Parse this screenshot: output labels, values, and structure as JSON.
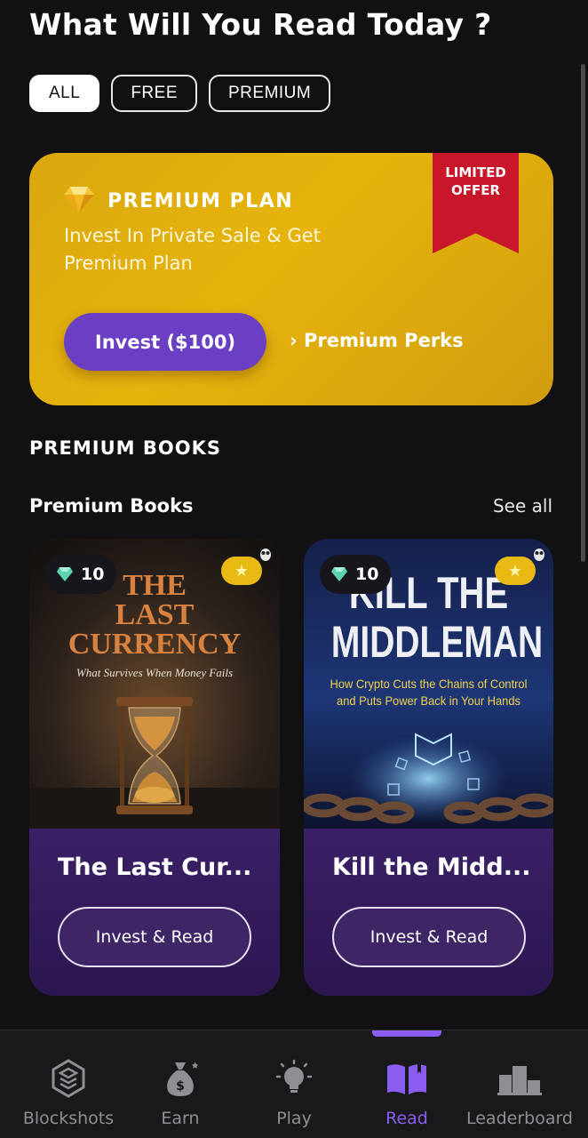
{
  "header": {
    "title": "What Will You Read Today ?"
  },
  "filters": [
    {
      "label": "ALL",
      "active": true
    },
    {
      "label": "FREE",
      "active": false
    },
    {
      "label": "PREMIUM",
      "active": false
    }
  ],
  "promo": {
    "ribbon_line1": "LIMITED",
    "ribbon_line2": "OFFER",
    "title": "PREMIUM PLAN",
    "subtitle": "Invest In Private Sale & Get Premium Plan",
    "cta_label": "Invest ($100)",
    "perks_label": "› Premium Perks",
    "icon": "diamond-icon"
  },
  "section": {
    "title": "PREMIUM BOOKS",
    "subtitle": "Premium Books",
    "see_all": "See all"
  },
  "books": [
    {
      "title": "The Last Cur...",
      "price": "10",
      "button_label": "Invest & Read",
      "cover": {
        "line1": "THE",
        "line2": "LAST",
        "line3": "CURRENCY",
        "tagline": "What Survives When Money Fails"
      }
    },
    {
      "title": "Kill the Midd...",
      "price": "10",
      "button_label": "Invest & Read",
      "cover": {
        "line1": "KILL THE",
        "line2": "MIDDLEMAN",
        "tagline1": "How Crypto Cuts the Chains of Control",
        "tagline2": "and Puts Power Back in Your Hands"
      }
    }
  ],
  "nav": {
    "items": [
      {
        "label": "Blockshots",
        "icon": "layers-icon"
      },
      {
        "label": "Earn",
        "icon": "money-bag-icon"
      },
      {
        "label": "Play",
        "icon": "lightbulb-icon"
      },
      {
        "label": "Read",
        "icon": "book-icon",
        "active": true
      },
      {
        "label": "Leaderboard",
        "icon": "podium-icon"
      }
    ]
  },
  "colors": {
    "background": "#111114",
    "accent": "#8a5cf0",
    "promo_gold": "#e6b40c",
    "ribbon_red": "#c8162a",
    "invest_purple": "#6a3fc4",
    "card_purple": "#311a57"
  }
}
